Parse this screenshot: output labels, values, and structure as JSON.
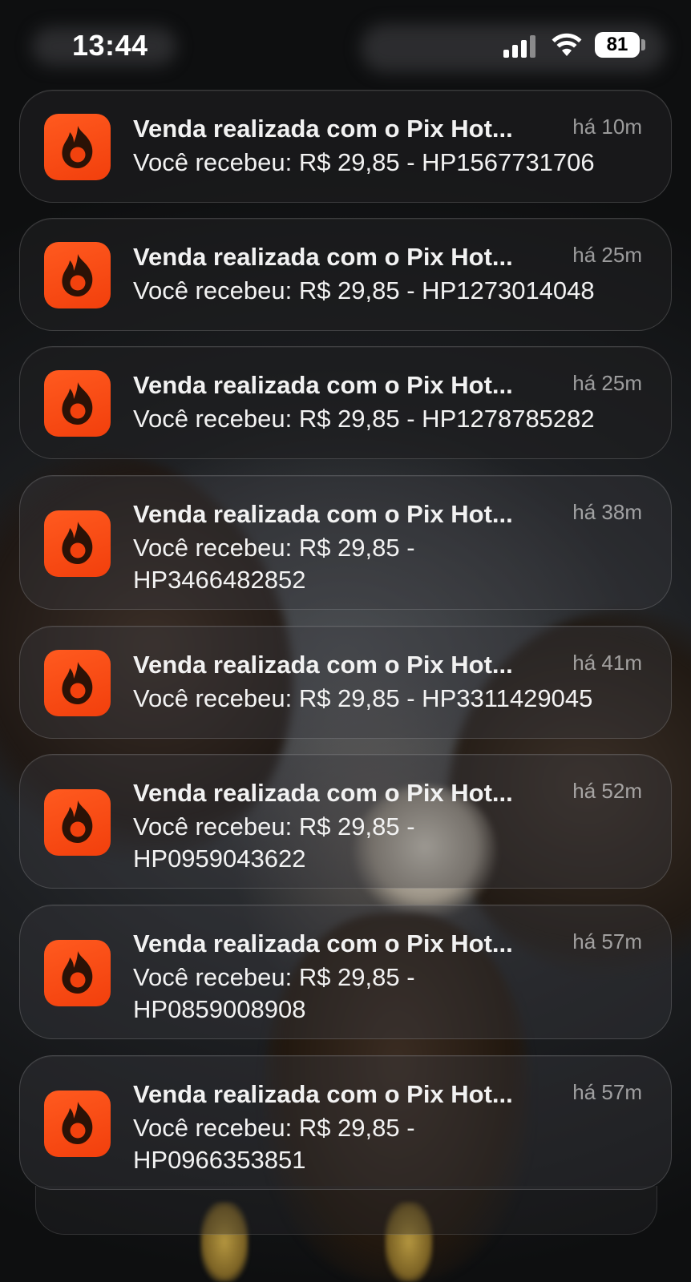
{
  "status_bar": {
    "time": "13:44",
    "battery": "81",
    "icons": [
      "cellular-signal-icon",
      "wifi-icon",
      "battery-icon"
    ]
  },
  "app": {
    "icon": "hotmart-flame-icon",
    "brand_color": "#F94A14"
  },
  "notifications": [
    {
      "title": "Venda realizada com o Pix Hot...",
      "time": "há 10m",
      "body": "Você recebeu: R$ 29,85 - HP1567731706"
    },
    {
      "title": "Venda realizada com o Pix Hot...",
      "time": "há 25m",
      "body": "Você recebeu: R$ 29,85 - HP1273014048"
    },
    {
      "title": "Venda realizada com o Pix Hot...",
      "time": "há 25m",
      "body": "Você recebeu: R$ 29,85 - HP1278785282"
    },
    {
      "title": "Venda realizada com o Pix Hot...",
      "time": "há 38m",
      "body": "Você recebeu: R$ 29,85 - HP3466482852"
    },
    {
      "title": "Venda realizada com o Pix Hot...",
      "time": "há 41m",
      "body": "Você recebeu: R$ 29,85 - HP3311429045"
    },
    {
      "title": "Venda realizada com o Pix Hot...",
      "time": "há 52m",
      "body": "Você recebeu: R$ 29,85 - HP0959043622"
    },
    {
      "title": "Venda realizada com o Pix Hot...",
      "time": "há 57m",
      "body": "Você recebeu: R$ 29,85 - HP0859008908"
    },
    {
      "title": "Venda realizada com o Pix Hot...",
      "time": "há 57m",
      "body": "Você recebeu: R$ 29,85 - HP0966353851"
    }
  ]
}
